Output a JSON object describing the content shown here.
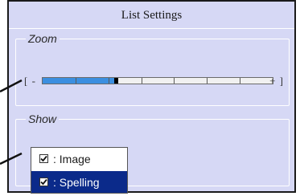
{
  "title": "List Settings",
  "zoom": {
    "legend": "Zoom",
    "left_cap": "[ -",
    "right_cap": "+ ]",
    "level": 0.33,
    "steps": 7,
    "accent_color": "#3c8fe0"
  },
  "show": {
    "legend": "Show",
    "items": [
      {
        "label": ": Image",
        "checked": true,
        "selected": false
      },
      {
        "label": ": Spelling",
        "checked": true,
        "selected": true
      }
    ],
    "selected_color": "#0b2a8a"
  },
  "colors": {
    "panel": "#d6d8f5"
  }
}
